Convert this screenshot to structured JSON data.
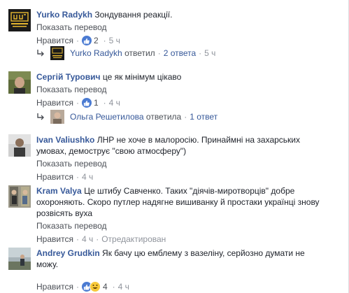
{
  "comments": [
    {
      "author": "Yurko Radykh",
      "text": "Зондування реакції.",
      "translate": "Показать перевод",
      "like": "Нравится",
      "reaction_count": "2",
      "time": "5 ч",
      "replies": {
        "author": "Yurko Radykh",
        "action": "ответил",
        "count": "2 ответа",
        "time": "5 ч"
      }
    },
    {
      "author": "Сергій Турович",
      "text": "це як мінімум цікаво",
      "translate": "Показать перевод",
      "like": "Нравится",
      "reaction_count": "1",
      "time": "4 ч",
      "replies": {
        "author": "Ольга Решетилова",
        "action": "ответила",
        "count": "1 ответ"
      }
    },
    {
      "author": "Ivan Valiushko",
      "text": "ЛНР не хоче в малоросію. Принаймні на захарських умовах, демострує \"свою атмосферу\")",
      "translate": "Показать перевод",
      "like": "Нравится",
      "time": "4 ч"
    },
    {
      "author": "Kram Valya",
      "text": "Це штибу Савченко. Таких \"діячів-миротворців\" добре охороняють. Скоро путлер надягне вишиванку й простаки українці знову розвісять вуха",
      "translate": "Показать перевод",
      "like": "Нравится",
      "time": "4 ч",
      "edited": "Отредактирован"
    },
    {
      "author": "Andrey Grudkin",
      "text": "Як бачу цю емблему з вазеліну, серйозно думати не можу.",
      "like": "Нравится",
      "reaction_count": "4",
      "time": "4 ч"
    }
  ]
}
